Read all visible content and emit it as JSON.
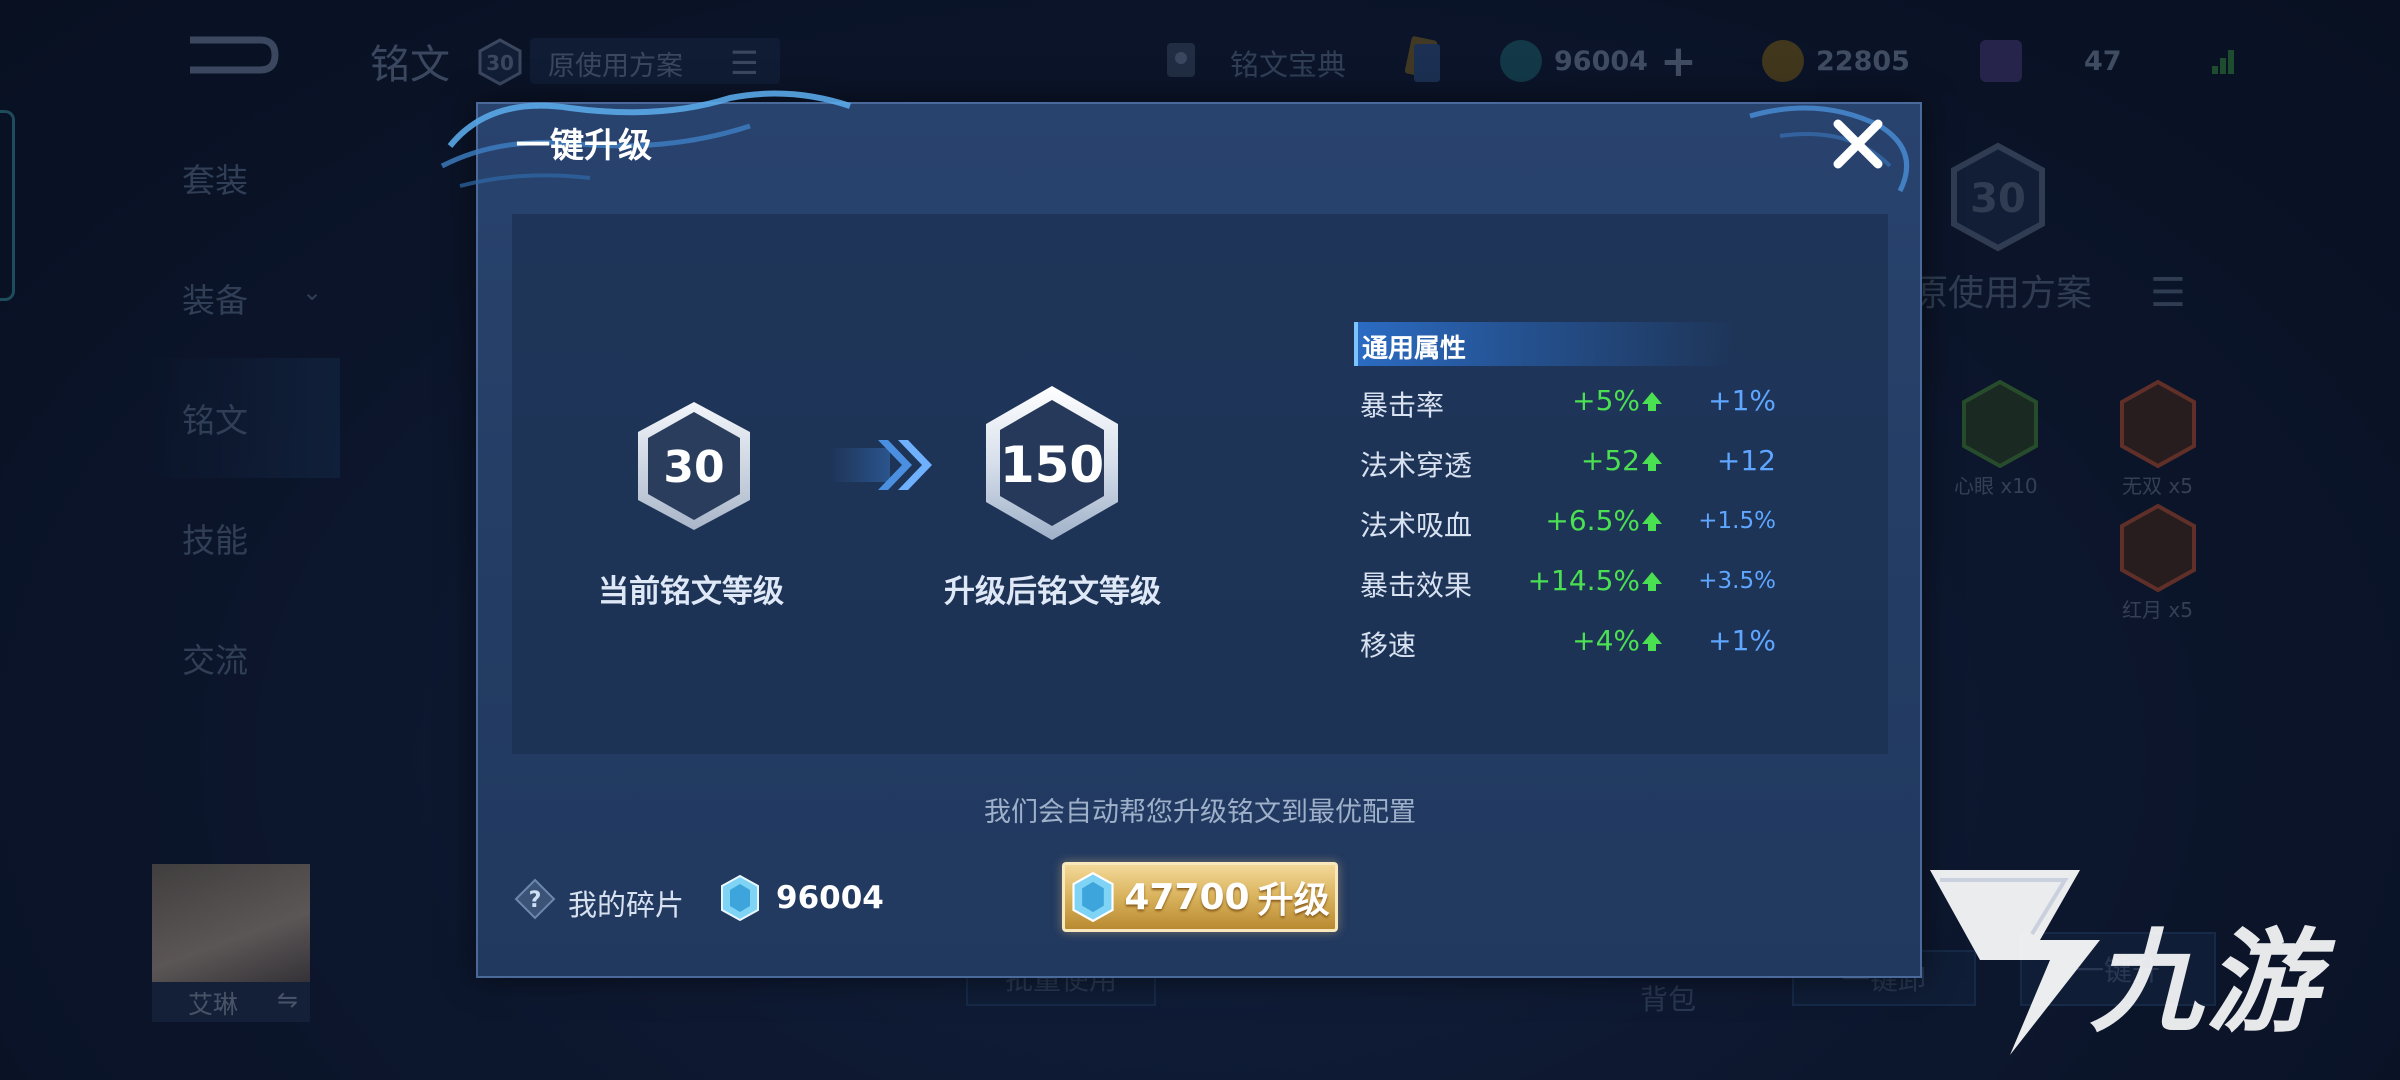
{
  "background": {
    "page_title": "铭文",
    "level_badge": "30",
    "scheme_name": "原使用方案",
    "codex_label": "铭文宝典",
    "resources": [
      {
        "icon": "shard-icon",
        "value": "96004",
        "has_add": true,
        "color": "#2aa0b8"
      },
      {
        "icon": "coin-icon",
        "value": "22805",
        "has_add": false,
        "color": "#c8951c"
      },
      {
        "icon": "gem-icon",
        "value": "47",
        "has_add": false,
        "color": "#6f5fc8"
      }
    ],
    "nav_items": [
      "套装",
      "装备",
      "铭文",
      "技能",
      "交流"
    ],
    "hero_name": "艾琳",
    "swap_glyph": "⇋",
    "right_level": "30",
    "right_scheme": "原使用方案",
    "rune_items": [
      {
        "label": "心眼 x10",
        "color": "#3f7a3a"
      },
      {
        "label": "无双 x5",
        "color": "#a04a33"
      },
      {
        "label": "红月 x5",
        "color": "#a04a33"
      }
    ],
    "bottom_buttons": [
      "批量使用",
      "背包",
      "一键卸",
      "一键升"
    ],
    "watermark_text": "九游"
  },
  "dialog": {
    "title": "一键升级",
    "close_glyph": "✕",
    "current_level": "30",
    "current_label": "当前铭文等级",
    "upgraded_level": "150",
    "upgraded_label": "升级后铭文等级",
    "attributes_header": "通用属性",
    "attributes": [
      {
        "name": "暴击率",
        "gain": "+5%",
        "current": "+1%",
        "small": false
      },
      {
        "name": "法术穿透",
        "gain": "+52",
        "current": "+12",
        "small": false
      },
      {
        "name": "法术吸血",
        "gain": "+6.5%",
        "current": "+1.5%",
        "small": true
      },
      {
        "name": "暴击效果",
        "gain": "+14.5%",
        "current": "+3.5%",
        "small": true
      },
      {
        "name": "移速",
        "gain": "+4%",
        "current": "+1%",
        "small": false
      }
    ],
    "auto_upgrade_note": "我们会自动帮您升级铭文到最优配置",
    "my_shards_label": "我的碎片",
    "my_shards_value": "96004",
    "upgrade_cost": "47700",
    "upgrade_verb": "升级",
    "colors": {
      "gain": "#4be052",
      "current": "#5ea6ff",
      "button_gold": "#d9b25c"
    }
  }
}
